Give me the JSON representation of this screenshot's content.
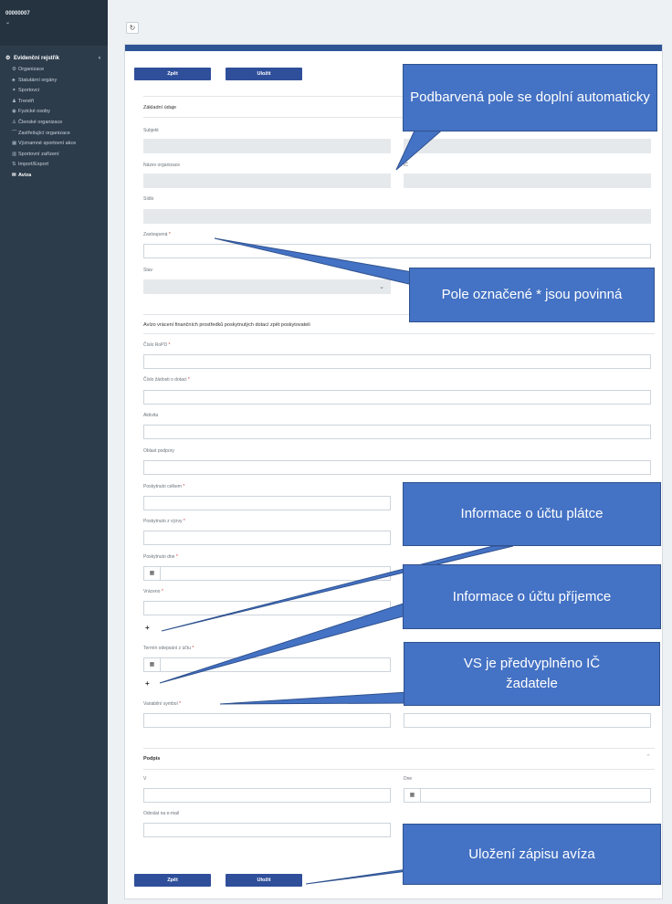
{
  "sidebar": {
    "org_code": "00000007",
    "section_label": "Evidenční rejstřík",
    "items": [
      {
        "label": "Organizace",
        "icon": "gear-icon",
        "active": false
      },
      {
        "label": "Statutární orgány",
        "icon": "users-icon",
        "active": false
      },
      {
        "label": "Sportovci",
        "icon": "runner-icon",
        "active": false
      },
      {
        "label": "Trenéři",
        "icon": "person-icon",
        "active": false
      },
      {
        "label": "Fyzické osoby",
        "icon": "globe-icon",
        "active": false
      },
      {
        "label": "Členské organizace",
        "icon": "user-plus-icon",
        "active": false
      },
      {
        "label": "Zastřešující organizace",
        "icon": "umbrella-icon",
        "active": false
      },
      {
        "label": "Významné sportovní akce",
        "icon": "grid-icon",
        "active": false
      },
      {
        "label": "Sportovní zařízení",
        "icon": "building-icon",
        "active": false
      },
      {
        "label": "Import/Export",
        "icon": "transfer-icon",
        "active": false
      },
      {
        "label": "Avíza",
        "icon": "envelope-icon",
        "active": true
      }
    ]
  },
  "toolbar": {
    "refresh_icon": "refresh-icon"
  },
  "form": {
    "back_label": "Zpět",
    "save_label": "Uložit",
    "basic_section": "Základní údaje",
    "subject_label": "Subjekt",
    "org_name_label": "Název organizace",
    "ic_label": "IČ",
    "seat_label": "Sídlo",
    "represented_label": "Zastoupená",
    "state_label": "Stav",
    "notice_section": "Avízo vrácení finančních prostředků poskytnutých dotací zpět poskytovateli",
    "ropd_label": "Číslo RoPD",
    "app_number_label": "Číslo žádosti o dotaci",
    "activity_label": "Aktivita",
    "support_area_label": "Oblast podpory",
    "total_label": "Poskytnuto celkem",
    "advance_label": "Poskytnuto z výzvy",
    "date_label": "Poskytnuto dne",
    "returned_label": "Vráceno",
    "debit_date_label": "Termín odepsání z účtu",
    "vs_label": "Variabilní symbol",
    "signature_section": "Podpis",
    "place_label": "V",
    "sign_date_label": "Dne",
    "email_label": "Odeslat na e-mail",
    "required_mark": "*",
    "plus_symbol": "+"
  },
  "callouts": {
    "auto_fill": "Podbarvená pole se doplní automaticky",
    "required": "Pole označené * jsou povinná",
    "payer_account": "Informace o účtu plátce",
    "recipient_account": "Informace o účtu příjemce",
    "vs_prefill": "VS je předvyplněno IČ žadatele",
    "save_notice": "Uložení zápisu avíza"
  },
  "colors": {
    "sidebar_bg": "#2d3c4b",
    "primary_button": "#2f4f9a",
    "callout_fill": "#4472c4",
    "required_star": "#d23b3b"
  }
}
